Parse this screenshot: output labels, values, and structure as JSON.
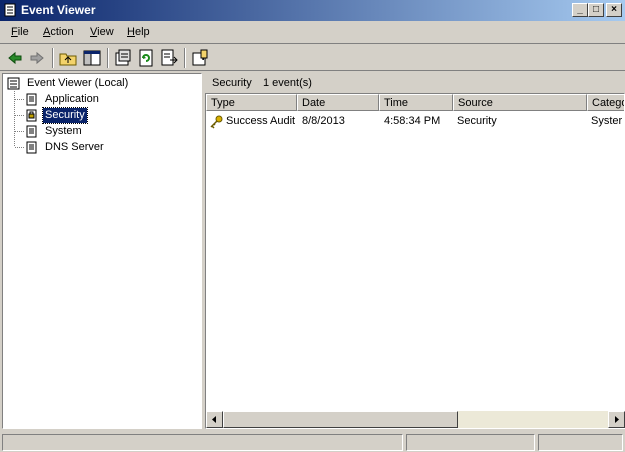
{
  "window": {
    "title": "Event Viewer"
  },
  "menu": [
    {
      "label": "File",
      "accel": "F",
      "rest": "ile"
    },
    {
      "label": "Action",
      "accel": "A",
      "rest": "ction"
    },
    {
      "label": "View",
      "accel": "V",
      "rest": "iew"
    },
    {
      "label": "Help",
      "accel": "H",
      "rest": "elp"
    }
  ],
  "toolbar": [
    "back-icon",
    "forward-icon",
    "up-folder-icon",
    "show-hide-tree-icon",
    "properties-icon",
    "refresh-icon",
    "export-list-icon",
    "help-icon"
  ],
  "tree": {
    "root": "Event Viewer (Local)",
    "items": [
      "Application",
      "Security",
      "System",
      "DNS Server"
    ],
    "selected": "Security"
  },
  "list": {
    "header_title": "Security",
    "header_count": "1 event(s)",
    "columns": [
      "Type",
      "Date",
      "Time",
      "Source",
      "Catego"
    ],
    "rows": [
      {
        "type": "Success Audit",
        "date": "8/8/2013",
        "time": "4:58:34 PM",
        "source": "Security",
        "category": "Syster"
      }
    ]
  },
  "colors": {
    "title_start": "#0a246a",
    "title_end": "#a6caf0",
    "selection": "#0a246a",
    "face": "#d4d0c8"
  }
}
